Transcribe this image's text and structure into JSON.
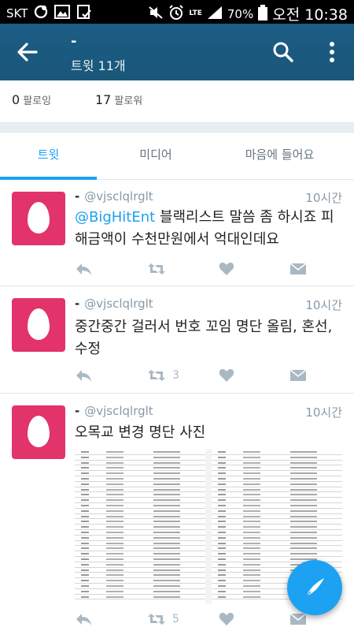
{
  "status_bar": {
    "carrier": "SKT",
    "lte": "LTE",
    "battery": "70%",
    "time": "오전 10:38",
    "icons": [
      "notification-icon",
      "gallery-icon",
      "checklist-icon",
      "mute-icon",
      "alarm-icon",
      "signal-icon",
      "battery-icon"
    ]
  },
  "app_bar": {
    "title": "-",
    "subtitle": "트윗 11개",
    "icons": [
      "back-arrow-icon",
      "search-icon",
      "more-vert-icon"
    ]
  },
  "counts": {
    "following_value": "0",
    "following_label": "팔로잉",
    "followers_value": "17",
    "followers_label": "팔로워"
  },
  "tabs": [
    {
      "label": "트윗",
      "active": true
    },
    {
      "label": "미디어",
      "active": false
    },
    {
      "label": "마음에 들어요",
      "active": false
    }
  ],
  "tweets": [
    {
      "name": "-",
      "handle": "@vjsclqlrglt",
      "time": "10시간",
      "mention": "@BigHitEnt",
      "text": " 블랙리스트 말씀 좀 하시죠 피해금액이 수천만원에서 억대인데요",
      "retweets": "",
      "likes": ""
    },
    {
      "name": "-",
      "handle": "@vjsclqlrglt",
      "time": "10시간",
      "mention": "",
      "text": "중간중간 걸러서 번호 꼬임 명단 올림, 혼선, 수정",
      "retweets": "3",
      "likes": ""
    },
    {
      "name": "-",
      "handle": "@vjsclqlrglt",
      "time": "10시간",
      "mention": "",
      "text": "오목교 변경 명단 사진",
      "retweets": "5",
      "likes": ""
    }
  ],
  "colors": {
    "appbar": "#1c5d86",
    "accent": "#1da1f2",
    "avatar": "#e2336b",
    "action_icons": "#aab8c2"
  },
  "fab": {
    "icon": "compose-tweet-icon"
  }
}
